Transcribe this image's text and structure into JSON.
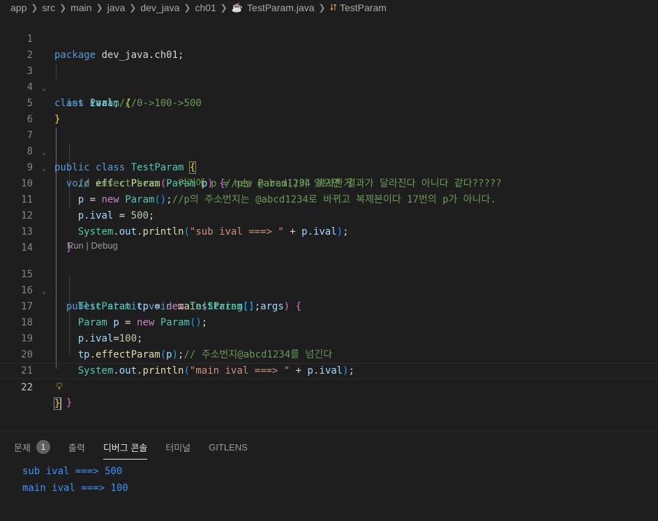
{
  "breadcrumb": {
    "items": [
      "app",
      "src",
      "main",
      "java",
      "dev_java",
      "ch01"
    ],
    "file": "TestParam.java",
    "symbol": "TestParam"
  },
  "editor": {
    "line_numbers": [
      "1",
      "2",
      "3",
      "4",
      "5",
      "6",
      "7",
      "8",
      "9",
      "10",
      "11",
      "12",
      "13",
      "14",
      "15",
      "16",
      "17",
      "18",
      "19",
      "20",
      "21",
      "22"
    ],
    "codelens": {
      "run": "Run",
      "separator": " | ",
      "debug": "Debug"
    },
    "code": {
      "l1_kw": "package",
      "l1_pkg": " dev_java.ch01;",
      "l3_kw": "class",
      "l3_name": "Param",
      "l4_kw": "int",
      "l4_var": "ival",
      "l4_comment": "///0->100->500",
      "l7_kw1": "public",
      "l7_kw2": "class",
      "l7_name": "TestParam",
      "l8_kw": "void",
      "l8_fn": "effectParam",
      "l8_type": "Param",
      "l8_param": "p",
      "l8_comment": "//p는 @abcd1234 복사한거",
      "l9_comment": "// insert here - 여기에 p = new Param()이 있으면 결과가 달라진다 아니다 같다?????",
      "l10_var": "p",
      "l10_kw": "new",
      "l10_type": "Param",
      "l10_comment": "//p의 주소번지는 @abcd1234로 바뀌고 복제본이다 17번의 p가 아니다.",
      "l11_var1": "p",
      "l11_var2": "ival",
      "l11_num": "500",
      "l12_type": "System",
      "l12_var": "out",
      "l12_fn": "println",
      "l12_str": "\"sub ival ===> \"",
      "l12_var2": "p",
      "l12_var3": "ival",
      "l15_kw1": "public",
      "l15_kw2": "static",
      "l15_kw3": "void",
      "l15_fn": "main",
      "l15_type": "String",
      "l15_param": "args",
      "l16_type1": "TestParam",
      "l16_var": "tp",
      "l16_kw": "new",
      "l16_type2": "TestParam",
      "l17_type1": "Param",
      "l17_var": "p",
      "l17_kw": "new",
      "l17_type2": "Param",
      "l18_var1": "p",
      "l18_var2": "ival",
      "l18_num": "100",
      "l19_var": "tp",
      "l19_fn": "effectParam",
      "l19_arg": "p",
      "l19_comment": "// 주소번지@abcd1234를 넘긴다",
      "l20_type": "System",
      "l20_var": "out",
      "l20_fn": "println",
      "l20_str": "\"main ival ===> \"",
      "l20_var2": "p",
      "l20_var3": "ival"
    }
  },
  "panel": {
    "tabs": [
      {
        "label": "문제",
        "badge": "1"
      },
      {
        "label": "출력"
      },
      {
        "label": "디버그 콘솔",
        "active": true
      },
      {
        "label": "터미널"
      },
      {
        "label": "GITLENS"
      }
    ],
    "console_lines": [
      "sub ival ===> 500",
      "main ival ===> 100"
    ]
  },
  "colors": {
    "background": "#1e1e1e",
    "keyword": "#569cd6",
    "type": "#4ec9b0",
    "function": "#dcdcaa",
    "variable": "#9cdcfe",
    "number": "#b5cea8",
    "string": "#ce9178",
    "comment": "#6a9955",
    "console_output": "#3794ff"
  },
  "icons": {
    "file": "java-cup-icon",
    "symbol": "class-symbol-icon",
    "lightbulb": "lightbulb-icon"
  }
}
